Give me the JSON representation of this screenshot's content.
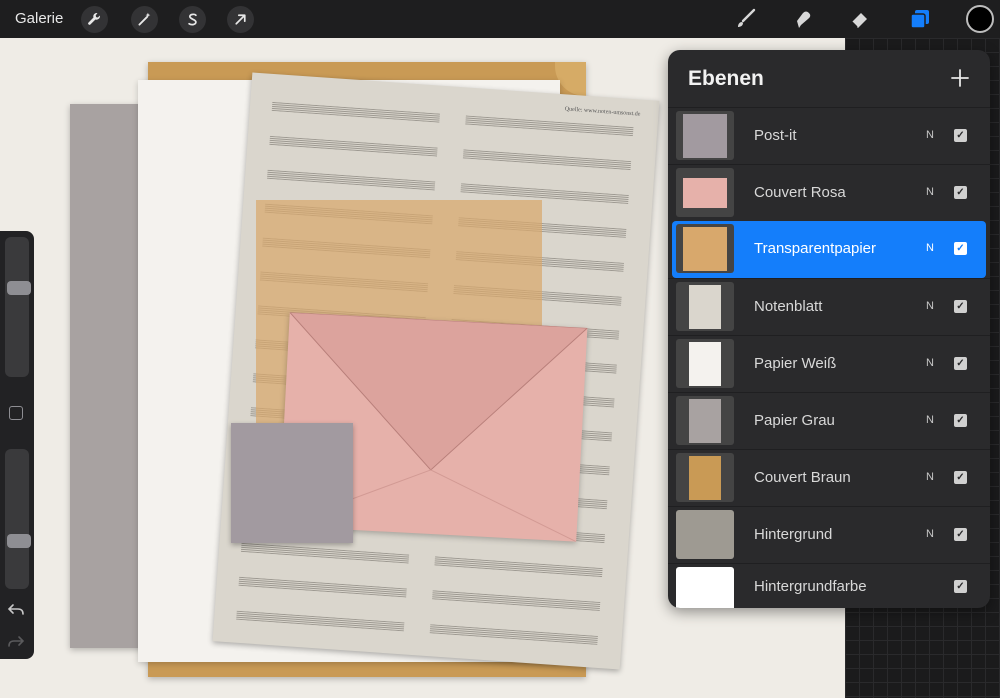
{
  "topbar": {
    "gallery_label": "Galerie",
    "left_tools": [
      "wrench-icon",
      "magic-wand-icon",
      "selection-s-icon",
      "transform-arrow-icon"
    ],
    "right_tools": [
      "brush-icon",
      "smudge-icon",
      "eraser-icon",
      "layers-icon"
    ],
    "active_color": "#000000",
    "accent": "#147efb"
  },
  "layers_panel": {
    "title": "Ebenen",
    "add_icon": "plus-icon",
    "layers": [
      {
        "name": "Post-it",
        "blend": "N",
        "visible": true,
        "thumb_color": "#a29aa0"
      },
      {
        "name": "Couvert Rosa",
        "blend": "N",
        "visible": true,
        "thumb_color": "#e6b1aa"
      },
      {
        "name": "Transparentpapier",
        "blend": "N",
        "visible": true,
        "thumb_color": "#d8a86c",
        "selected": true
      },
      {
        "name": "Notenblatt",
        "blend": "N",
        "visible": true,
        "thumb_color": "#dad6cd"
      },
      {
        "name": "Papier Weiß",
        "blend": "N",
        "visible": true,
        "thumb_color": "#f4f2ee"
      },
      {
        "name": "Papier Grau",
        "blend": "N",
        "visible": true,
        "thumb_color": "#a8a2a1"
      },
      {
        "name": "Couvert Braun",
        "blend": "N",
        "visible": true,
        "thumb_color": "#c99a55"
      },
      {
        "name": "Hintergrund",
        "blend": "N",
        "visible": true,
        "thumb_color": "#9e9a92"
      },
      {
        "name": "Hintergrundfarbe",
        "blend": "",
        "visible": true,
        "thumb_color": "#ffffff"
      }
    ]
  },
  "sheet_source": "Quelle: www.noten-umsonst.de"
}
